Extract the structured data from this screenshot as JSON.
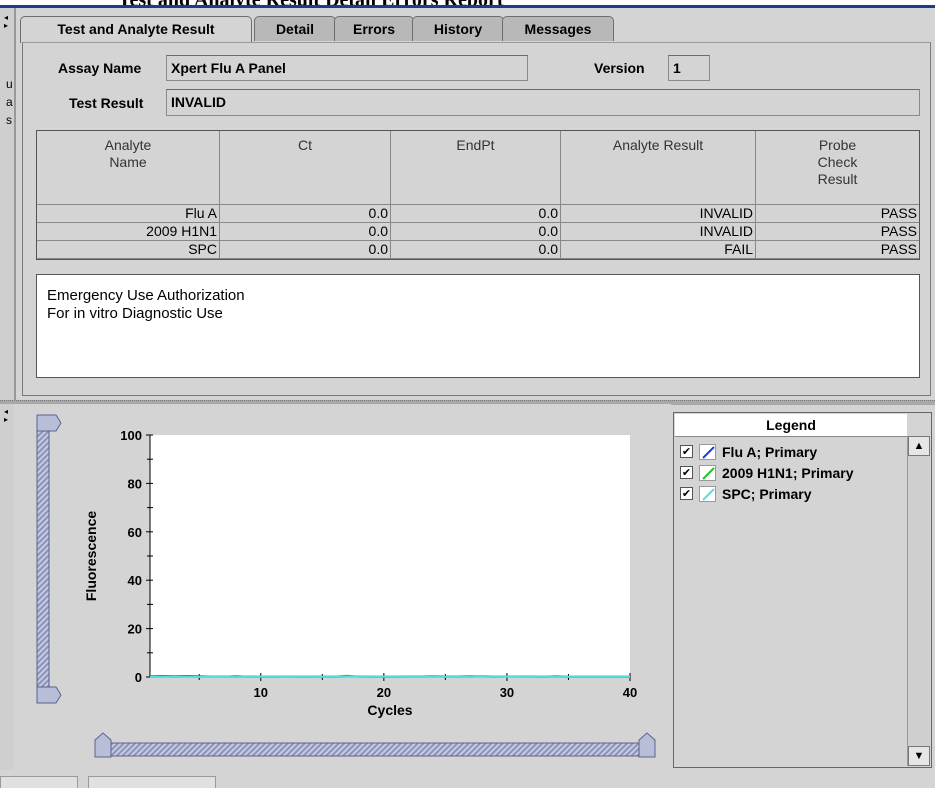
{
  "window_title_fragment": "Test and Analyte Result Detail Errors Report",
  "left_gutter_fragments": [
    "u",
    "a",
    "s"
  ],
  "tabs": [
    {
      "label": "Test and Analyte Result",
      "active": true
    },
    {
      "label": "Detail",
      "active": false
    },
    {
      "label": "Errors",
      "active": false
    },
    {
      "label": "History",
      "active": false
    },
    {
      "label": "Messages",
      "active": false
    }
  ],
  "assay": {
    "name_label": "Assay Name",
    "name_value": "Xpert Flu A Panel",
    "version_label": "Version",
    "version_value": "1"
  },
  "test_result": {
    "label": "Test Result",
    "value": "INVALID"
  },
  "results_table": {
    "columns": [
      "Analyte Name",
      "Ct",
      "EndPt",
      "Analyte Result",
      "Probe Check Result"
    ],
    "rows": [
      [
        "Flu A",
        "0.0",
        "0.0",
        "INVALID",
        "PASS"
      ],
      [
        "2009 H1N1",
        "0.0",
        "0.0",
        "INVALID",
        "PASS"
      ],
      [
        "SPC",
        "0.0",
        "0.0",
        "FAIL",
        "PASS"
      ]
    ]
  },
  "notes": {
    "line1": "Emergency Use Authorization",
    "line2": "For in vitro Diagnostic Use"
  },
  "legend": {
    "title": "Legend",
    "items": [
      {
        "label": "Flu A; Primary",
        "checked": true,
        "color": "#1f3fd6"
      },
      {
        "label": "2009 H1N1; Primary",
        "checked": true,
        "color": "#22c32a"
      },
      {
        "label": "SPC; Primary",
        "checked": true,
        "color": "#4fe0e0"
      }
    ]
  },
  "chart_data": {
    "type": "line",
    "title": "",
    "xlabel": "Cycles",
    "ylabel": "Fluorescence",
    "xlim": [
      1,
      40
    ],
    "ylim": [
      0,
      100
    ],
    "xticks": [
      10,
      20,
      30,
      40
    ],
    "yticks": [
      0,
      20,
      40,
      60,
      80,
      100
    ],
    "grid": false,
    "legend_position": "right panel",
    "series": [
      {
        "name": "Flu A; Primary",
        "color": "#1f3fd6",
        "x": [
          1,
          2,
          3,
          4,
          5,
          6,
          7,
          8,
          9,
          10,
          11,
          12,
          13,
          14,
          15,
          16,
          17,
          18,
          19,
          20,
          21,
          22,
          23,
          24,
          25,
          26,
          27,
          28,
          29,
          30,
          31,
          32,
          33,
          34,
          35,
          36,
          37,
          38,
          39,
          40
        ],
        "y": [
          0.3,
          0.4,
          0.3,
          0.4,
          0.3,
          0.2,
          0.2,
          0.1,
          0.2,
          0.1,
          0.1,
          0.2,
          0.1,
          0.1,
          0.2,
          0.1,
          0.2,
          0.2,
          0.1,
          0.1,
          0.1,
          0.2,
          0.2,
          0.3,
          0.2,
          0.2,
          0.3,
          0.2,
          0.1,
          0.2,
          0.2,
          0.2,
          0.1,
          0.3,
          0.1,
          0.1,
          0.1,
          0.1,
          0.1,
          0.1
        ]
      },
      {
        "name": "2009 H1N1; Primary",
        "color": "#22c32a",
        "x": [
          1,
          2,
          3,
          4,
          5,
          6,
          7,
          8,
          9,
          10,
          11,
          12,
          13,
          14,
          15,
          16,
          17,
          18,
          19,
          20,
          21,
          22,
          23,
          24,
          25,
          26,
          27,
          28,
          29,
          30,
          31,
          32,
          33,
          34,
          35,
          36,
          37,
          38,
          39,
          40
        ],
        "y": [
          0.1,
          0.2,
          0.1,
          0.2,
          0.1,
          0.2,
          0.1,
          0.4,
          0.1,
          0.1,
          0.1,
          0.2,
          0.1,
          0.1,
          0.1,
          0.1,
          0.5,
          0.1,
          0.1,
          0.1,
          0.1,
          0.1,
          0.1,
          0.2,
          0.1,
          0.1,
          0.1,
          0.3,
          0.2,
          0.2,
          0.1,
          0.1,
          0.1,
          0.1,
          0.1,
          0.2,
          0.1,
          0.1,
          0.2,
          0.1
        ]
      },
      {
        "name": "SPC; Primary",
        "color": "#4fe0e0",
        "x": [
          1,
          2,
          3,
          4,
          5,
          6,
          7,
          8,
          9,
          10,
          11,
          12,
          13,
          14,
          15,
          16,
          17,
          18,
          19,
          20,
          21,
          22,
          23,
          24,
          25,
          26,
          27,
          28,
          29,
          30,
          31,
          32,
          33,
          34,
          35,
          36,
          37,
          38,
          39,
          40
        ],
        "y": [
          0.1,
          0.1,
          0.1,
          0.1,
          0.1,
          0.1,
          0.1,
          0.1,
          0.1,
          0.1,
          0.1,
          0.1,
          0.1,
          0.1,
          0.1,
          0.1,
          0.1,
          0.1,
          0.1,
          0.1,
          0.1,
          0.1,
          0.1,
          0.1,
          0.1,
          0.1,
          0.1,
          0.1,
          0.1,
          0.1,
          0.1,
          0.1,
          0.1,
          0.1,
          0.1,
          0.1,
          0.1,
          0.1,
          0.1,
          0.1
        ]
      }
    ]
  }
}
